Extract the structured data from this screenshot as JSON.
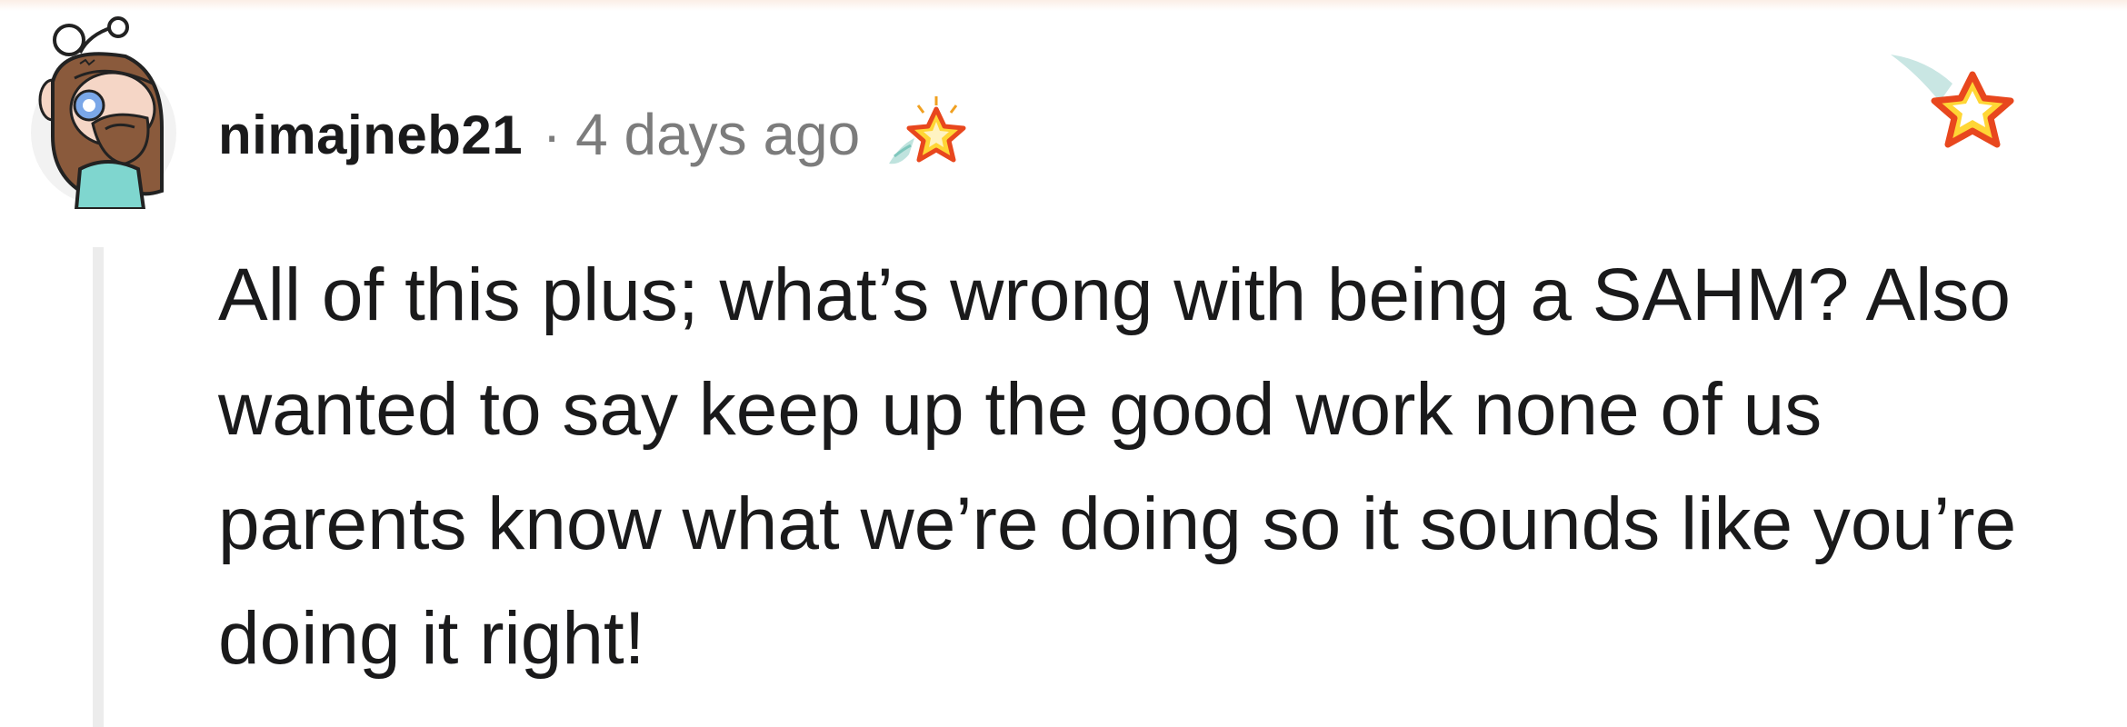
{
  "comment": {
    "username": "nimajneb21",
    "separator": "·",
    "timestamp": "4 days ago",
    "body": "All of this plus; what’s wrong with being a SAHM? Also wanted to say keep up the good work none of us parents know what we’re doing so it sounds like you’re doing it right!",
    "icons": {
      "avatar": "snoo-avatar-icon",
      "award": "rising-star-award-icon",
      "badge": "star-badge-icon"
    }
  },
  "colors": {
    "username": "#1a1a1b",
    "meta": "#7c7c7c",
    "thread_line": "#ececec",
    "star_fill": "#ffd635",
    "star_outline": "#e8471e"
  }
}
